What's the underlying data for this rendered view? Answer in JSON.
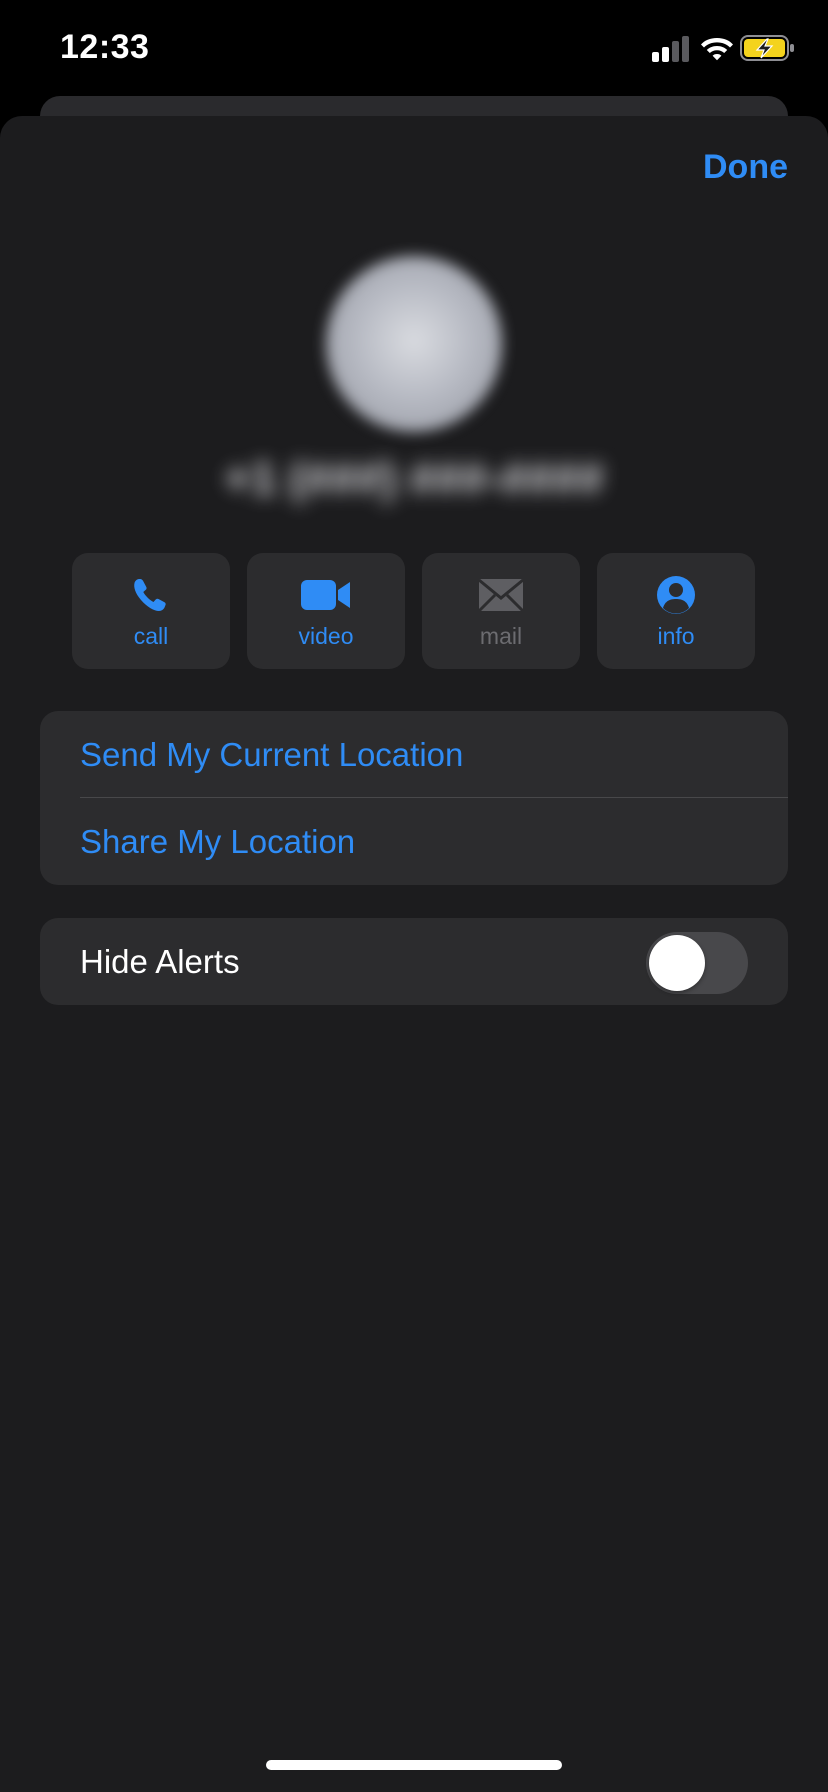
{
  "status_bar": {
    "time": "12:33",
    "icons": [
      "signal-icon",
      "wifi-icon",
      "battery-charging-icon"
    ],
    "battery_color": "#f4d31d"
  },
  "header": {
    "done_label": "Done"
  },
  "contact": {
    "avatar_icon": "contact-avatar",
    "name": "+1 (###) ###-####"
  },
  "actions": [
    {
      "label": "call",
      "icon": "phone-icon",
      "enabled": true
    },
    {
      "label": "video",
      "icon": "video-camera-icon",
      "enabled": true
    },
    {
      "label": "mail",
      "icon": "envelope-icon",
      "enabled": false
    },
    {
      "label": "info",
      "icon": "person-circle-icon",
      "enabled": true
    }
  ],
  "location_group": {
    "send_current_location": "Send My Current Location",
    "share_location": "Share My Location"
  },
  "alerts_group": {
    "hide_alerts_label": "Hide Alerts",
    "hide_alerts_on": false
  },
  "colors": {
    "accent": "#2f8cf5",
    "sheet_background": "#1c1c1e",
    "cell_background": "#2c2c2e",
    "disabled_text": "#6c6c70"
  }
}
